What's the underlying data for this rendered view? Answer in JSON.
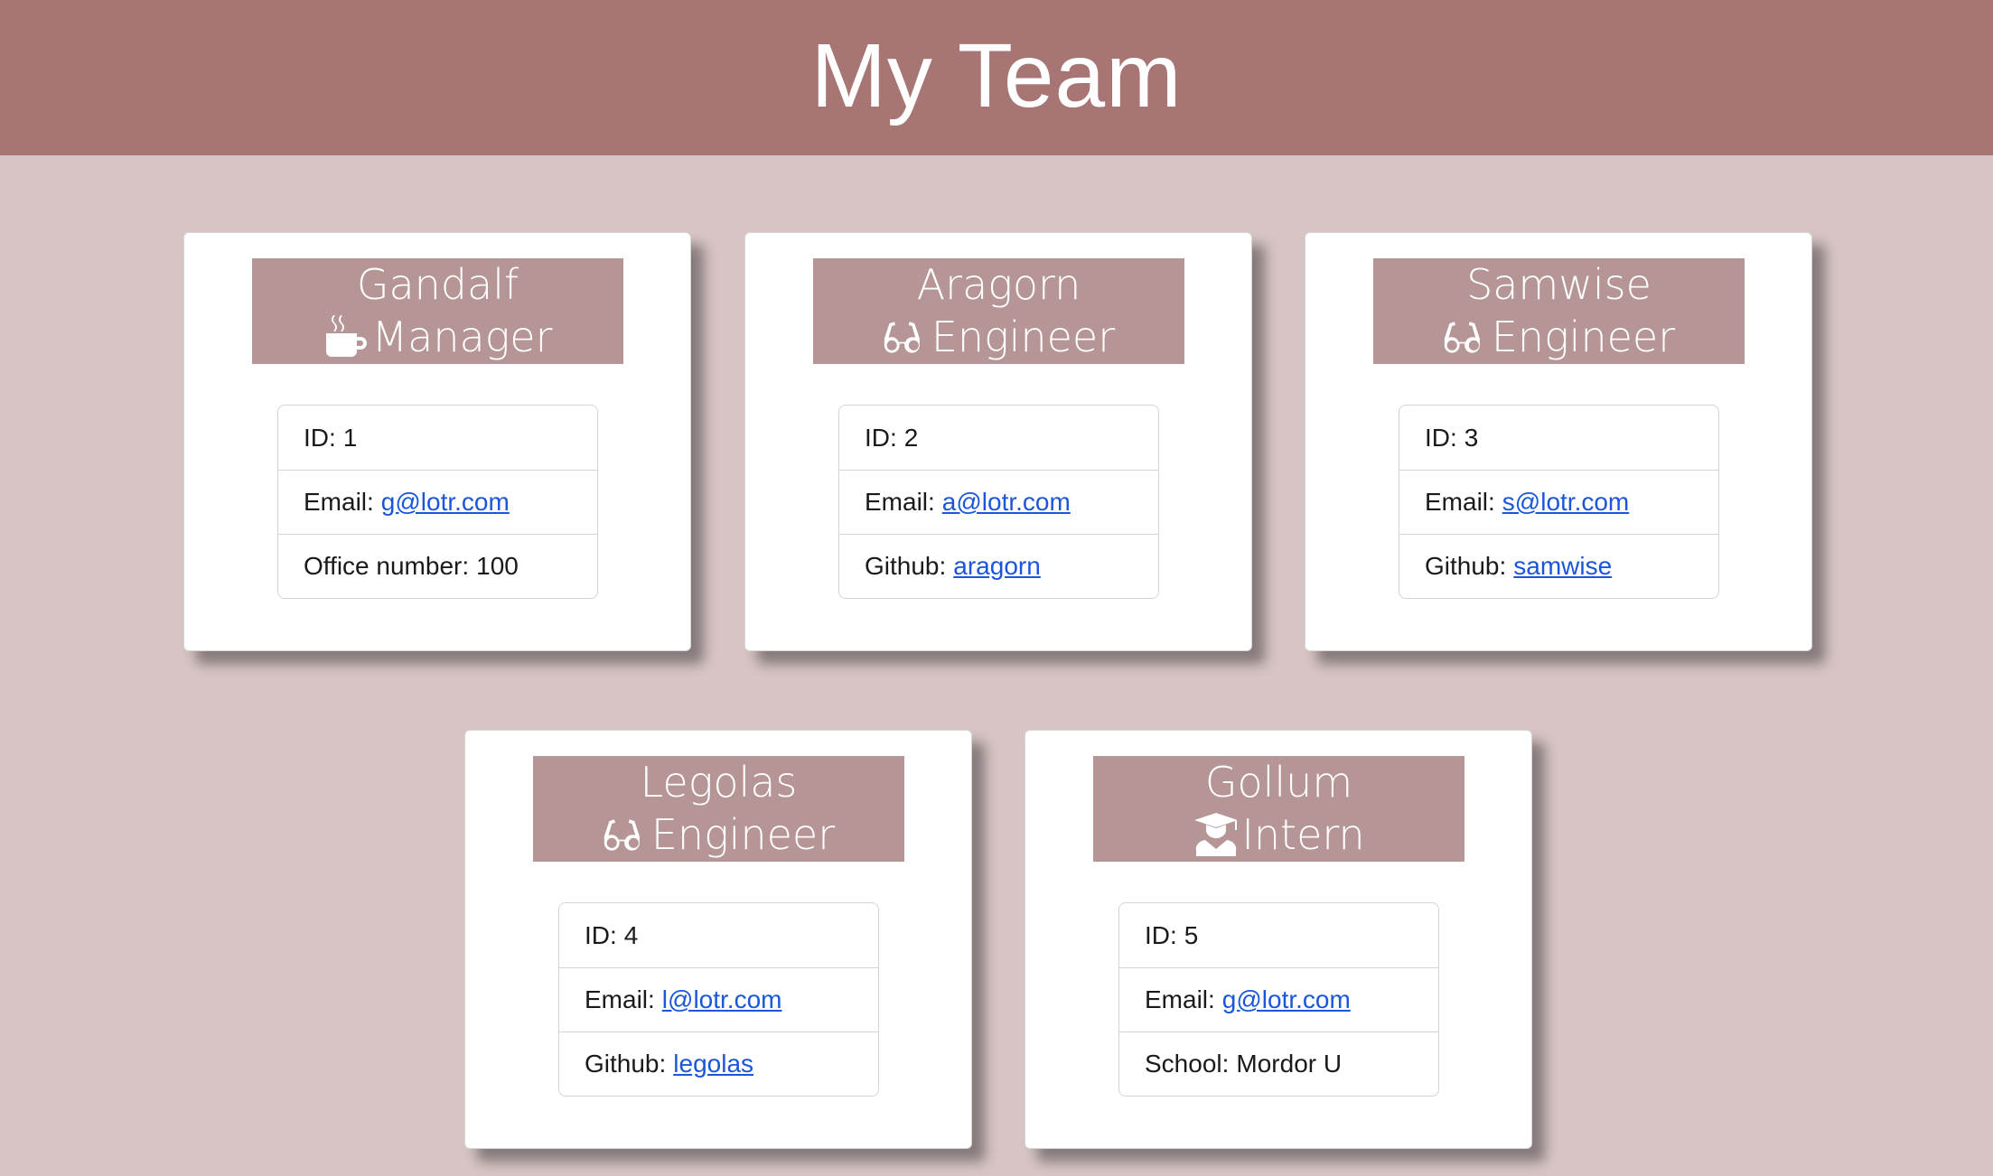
{
  "page": {
    "title": "My Team"
  },
  "team": [
    {
      "name": "Gandalf",
      "role": "Manager",
      "icon": "mug-icon",
      "id_label": "ID:",
      "id": "1",
      "email_label": "Email:",
      "email": "g@lotr.com",
      "extra_label": "Office number:",
      "extra": "100",
      "extra_is_link": false
    },
    {
      "name": "Aragorn",
      "role": "Engineer",
      "icon": "glasses-icon",
      "id_label": "ID:",
      "id": "2",
      "email_label": "Email:",
      "email": "a@lotr.com",
      "extra_label": "Github:",
      "extra": "aragorn",
      "extra_is_link": true
    },
    {
      "name": "Samwise",
      "role": "Engineer",
      "icon": "glasses-icon",
      "id_label": "ID:",
      "id": "3",
      "email_label": "Email:",
      "email": "s@lotr.com",
      "extra_label": "Github:",
      "extra": "samwise",
      "extra_is_link": true
    },
    {
      "name": "Legolas",
      "role": "Engineer",
      "icon": "glasses-icon",
      "id_label": "ID:",
      "id": "4",
      "email_label": "Email:",
      "email": "l@lotr.com",
      "extra_label": "Github:",
      "extra": "legolas",
      "extra_is_link": true
    },
    {
      "name": "Gollum",
      "role": "Intern",
      "icon": "graduate-icon",
      "id_label": "ID:",
      "id": "5",
      "email_label": "Email:",
      "email": "g@lotr.com",
      "extra_label": "School:",
      "extra": "Mordor U",
      "extra_is_link": false
    }
  ],
  "colors": {
    "header_bg": "#a77574",
    "page_bg": "#d7c4c4",
    "card_header_bg": "#b59595",
    "link": "#1a56db"
  }
}
